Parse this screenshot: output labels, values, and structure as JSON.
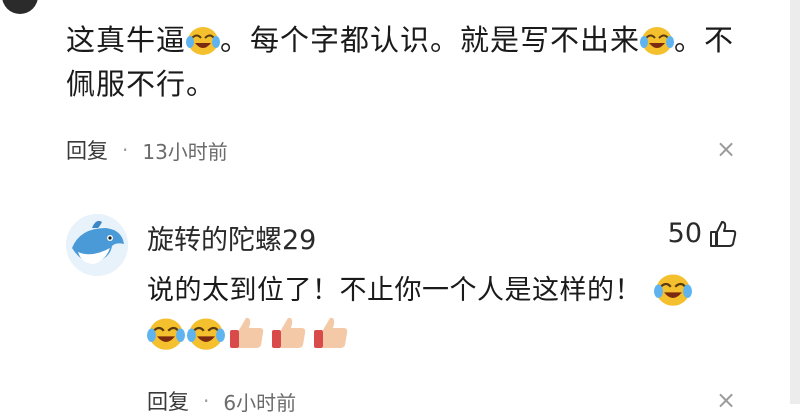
{
  "comment_top": {
    "text_line1_parts": [
      "这真牛逼",
      "。每个字都认识。就是写不出来",
      "。不"
    ],
    "text_line2": "佩服不行。",
    "reply_label": "回复",
    "separator": "·",
    "time": "13小时前",
    "close": "×"
  },
  "comment_reply": {
    "username": "旋转的陀螺29",
    "like_count": "50",
    "text": "说的太到位了！不止你一个人是这样的！",
    "emoji_row": [
      "laugh-cry-emoji",
      "laugh-cry-emoji",
      "thumbs-up-emoji",
      "thumbs-up-emoji",
      "thumbs-up-emoji"
    ],
    "reply_label": "回复",
    "separator": "·",
    "time": "6小时前",
    "close": "×"
  },
  "colors": {
    "text": "#1a1a1a",
    "meta": "#6b6b6b",
    "emoji_face": "#f5c02e",
    "thumb": "#f4c9a8"
  }
}
